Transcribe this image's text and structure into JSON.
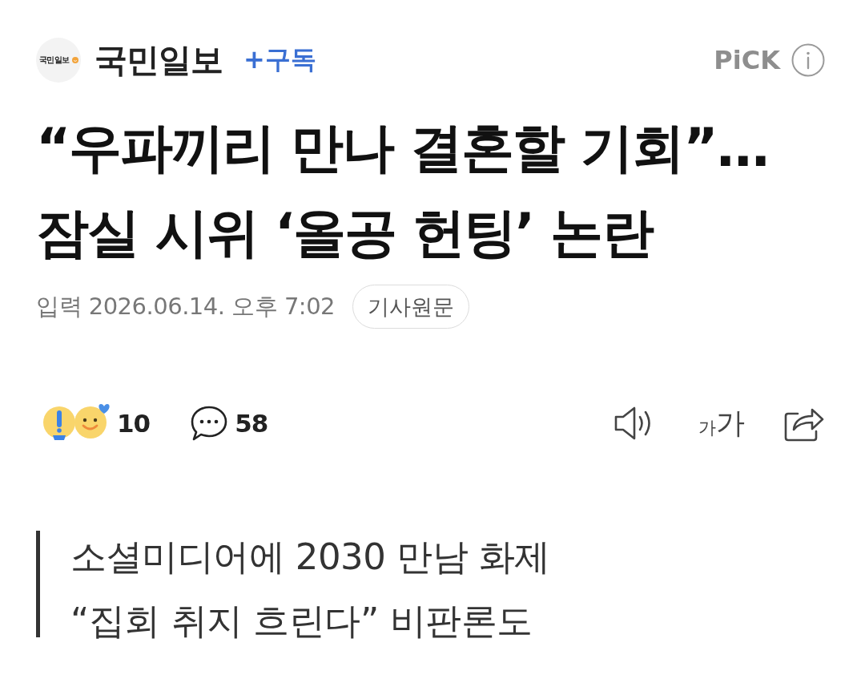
{
  "header": {
    "logo_text": "국민일보",
    "press_name": "국민일보",
    "subscribe_button": "+구독",
    "pick_label": "PiCK"
  },
  "headline": {
    "lines": [
      "“우파끼리 만나 결혼할 기회”…",
      "잠실 시위 ‘올공 헌팅’ 논란"
    ]
  },
  "meta": {
    "published": "입력 2026.06.14. 오후 7:02",
    "original_link": "기사원문"
  },
  "actions": {
    "reaction_count": "10",
    "comment_count": "58",
    "font_size_button": {
      "small": "가",
      "large": "가"
    }
  },
  "summary": {
    "lines": [
      "소셜미디어에 2030 만남 화제",
      "“집회 취지 흐린다” 비판론도"
    ]
  }
}
